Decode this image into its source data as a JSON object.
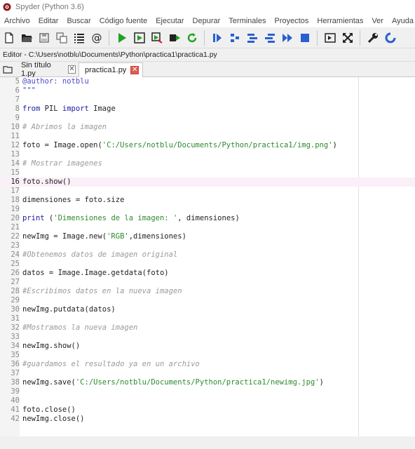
{
  "window": {
    "title": "Spyder (Python 3.6)"
  },
  "menu": [
    "Archivo",
    "Editar",
    "Buscar",
    "Código fuente",
    "Ejecutar",
    "Depurar",
    "Terminales",
    "Proyectos",
    "Herramientas",
    "Ver",
    "Ayuda"
  ],
  "toolbar": {
    "icons": [
      "new-file-icon",
      "open-folder-icon",
      "save-icon",
      "save-all-icon",
      "outline-icon",
      "at-sign-icon",
      "run-icon",
      "run-cell-icon",
      "run-cell-advance-icon",
      "run-selection-icon",
      "rerun-icon",
      "debug-icon",
      "step-icon",
      "step-into-icon",
      "step-return-icon",
      "continue-icon",
      "stop-icon",
      "maximize-pane-icon",
      "fullscreen-icon",
      "preferences-wrench-icon",
      "python-path-icon"
    ]
  },
  "editor": {
    "path_label": "Editor - C:\\Users\\notblu\\Documents\\Python\\practica1\\practica1.py"
  },
  "tabs": [
    {
      "label": "Sin título 1.py",
      "active": false
    },
    {
      "label": "practica1.py",
      "active": true
    }
  ],
  "code": {
    "current_line": "16",
    "lines": [
      {
        "n": "5",
        "t": "@author: notblu",
        "s": "dec"
      },
      {
        "n": "6",
        "t": "\"\"\"",
        "s": "dec"
      },
      {
        "n": "7",
        "t": "",
        "s": ""
      },
      {
        "n": "8",
        "parts": [
          {
            "t": "from",
            "s": "kw"
          },
          {
            "t": " PIL ",
            "s": ""
          },
          {
            "t": "import",
            "s": "kw"
          },
          {
            "t": " Image",
            "s": ""
          }
        ]
      },
      {
        "n": "9",
        "t": "",
        "s": ""
      },
      {
        "n": "10",
        "t": "# Abrimos la imagen",
        "s": "cmt"
      },
      {
        "n": "11",
        "t": "",
        "s": ""
      },
      {
        "n": "12",
        "parts": [
          {
            "t": "foto = Image.open(",
            "s": ""
          },
          {
            "t": "'C:/Users/notblu/Documents/Python/practica1/img.png'",
            "s": "str"
          },
          {
            "t": ")",
            "s": ""
          }
        ]
      },
      {
        "n": "13",
        "t": "",
        "s": ""
      },
      {
        "n": "14",
        "t": "# Mostrar imagenes",
        "s": "cmt"
      },
      {
        "n": "15",
        "t": "",
        "s": ""
      },
      {
        "n": "16",
        "t": "foto.show()",
        "s": ""
      },
      {
        "n": "17",
        "t": "",
        "s": ""
      },
      {
        "n": "18",
        "t": "dimensiones = foto.size",
        "s": ""
      },
      {
        "n": "19",
        "t": "",
        "s": ""
      },
      {
        "n": "20",
        "parts": [
          {
            "t": "print",
            "s": "kw"
          },
          {
            "t": " (",
            "s": ""
          },
          {
            "t": "'Dimensiones de la imagen: '",
            "s": "str"
          },
          {
            "t": ", dimensiones)",
            "s": ""
          }
        ]
      },
      {
        "n": "21",
        "t": "",
        "s": ""
      },
      {
        "n": "22",
        "parts": [
          {
            "t": "newImg = Image.new(",
            "s": ""
          },
          {
            "t": "'RGB'",
            "s": "str"
          },
          {
            "t": ",dimensiones)",
            "s": ""
          }
        ]
      },
      {
        "n": "23",
        "t": "",
        "s": ""
      },
      {
        "n": "24",
        "t": "#Obtenemos datos de imagen original",
        "s": "cmt"
      },
      {
        "n": "25",
        "t": "",
        "s": ""
      },
      {
        "n": "26",
        "t": "datos = Image.Image.getdata(foto)",
        "s": ""
      },
      {
        "n": "27",
        "t": "",
        "s": ""
      },
      {
        "n": "28",
        "t": "#Escribimos datos en la nueva imagen",
        "s": "cmt"
      },
      {
        "n": "29",
        "t": "",
        "s": ""
      },
      {
        "n": "30",
        "t": "newImg.putdata(datos)",
        "s": ""
      },
      {
        "n": "31",
        "t": "",
        "s": ""
      },
      {
        "n": "32",
        "t": "#Mostramos la nueva imagen",
        "s": "cmt"
      },
      {
        "n": "33",
        "t": "",
        "s": ""
      },
      {
        "n": "34",
        "t": "newImg.show()",
        "s": ""
      },
      {
        "n": "35",
        "t": "",
        "s": ""
      },
      {
        "n": "36",
        "t": "#guardamos el resultado ya en un archivo",
        "s": "cmt"
      },
      {
        "n": "37",
        "t": "",
        "s": ""
      },
      {
        "n": "38",
        "parts": [
          {
            "t": "newImg.save(",
            "s": ""
          },
          {
            "t": "'C:/Users/notblu/Documents/Python/practica1/newimg.jpg'",
            "s": "str"
          },
          {
            "t": ")",
            "s": ""
          }
        ]
      },
      {
        "n": "39",
        "t": "",
        "s": ""
      },
      {
        "n": "40",
        "t": "",
        "s": ""
      },
      {
        "n": "41",
        "t": "foto.close()",
        "s": ""
      },
      {
        "n": "42",
        "t": "newImg.close()",
        "s": ""
      }
    ]
  },
  "colors": {
    "current_line": "#fbeff8",
    "keyword": "#1a1aa6",
    "string": "#2d8a2d",
    "comment": "#9a9a9a",
    "run_green": "#1ea31e",
    "debug_blue": "#2a5fd1"
  }
}
